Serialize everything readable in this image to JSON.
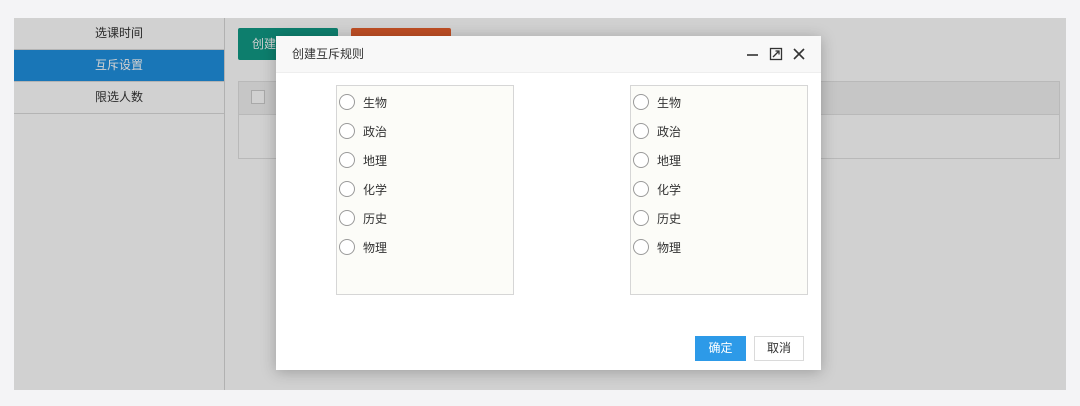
{
  "sidebar": {
    "items": [
      {
        "label": "选课时间",
        "active": false
      },
      {
        "label": "互斥设置",
        "active": true
      },
      {
        "label": "限选人数",
        "active": false
      }
    ]
  },
  "toolbar": {
    "create_label": "创建"
  },
  "modal": {
    "title": "创建互斥规则",
    "left_options": [
      "生物",
      "政治",
      "地理",
      "化学",
      "历史",
      "物理"
    ],
    "right_options": [
      "生物",
      "政治",
      "地理",
      "化学",
      "历史",
      "物理"
    ],
    "confirm_label": "确定",
    "cancel_label": "取消"
  },
  "colors": {
    "accent": "#1f90e0",
    "create_button": "#119a86",
    "delete_button": "#e8602c",
    "confirm_button": "#2d9ae8"
  },
  "icons": [
    "minimize-icon",
    "maximize-icon",
    "close-icon",
    "radio-icon"
  ]
}
